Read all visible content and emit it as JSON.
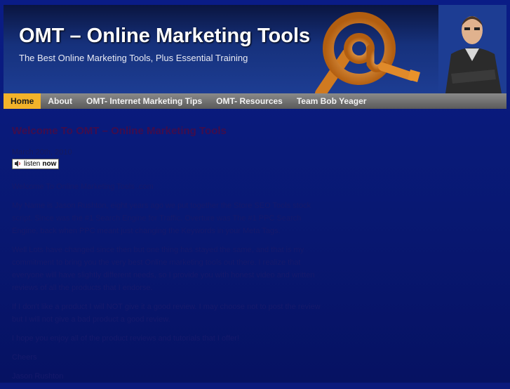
{
  "header": {
    "site_title": "OMT – Online Marketing Tools",
    "tagline": "The Best Online Marketing Tools, Plus Essential Training"
  },
  "nav": {
    "items": [
      {
        "label": "Home"
      },
      {
        "label": "About"
      },
      {
        "label": "OMT- Internet Marketing Tips"
      },
      {
        "label": "OMT- Resources"
      },
      {
        "label": "Team Bob Yeager"
      }
    ]
  },
  "post": {
    "title": "Welcome To OMT – Online Marketing Tools",
    "date": "March 20th, 2010",
    "listen_button": {
      "word1": "listen",
      "word2": "now"
    },
    "paragraphs": [
      "Welcome To Online Marketing Tools .com",
      "My Name is Jason Rushton, eight years ago we put together the Store SEO Tools stock script. Since was the #1 Search Engine for Traffic. Overture was The #1 PPC Search Engine, back when PPC meant just changing the Keywords in your Meta Tags.",
      "Well Lots have changed since then but one thing has stayed the same, and that is my commitment to bring you the very best Online marketing tools out there. I realize that everyone will have slightly different needs, so I provide you with honest video and written reviews of all the products that I endorse.",
      "If I don't like a product I will NOT give it a good review. I may choose not to post the review but I will not give a bad product a good review.",
      "I hope you enjoy all of the product reviews and tutorials that I offer!",
      "Cheers",
      "Jason Rushton"
    ]
  },
  "colors": {
    "page_background": "#0b1a7c",
    "nav_active": "#f2b32a",
    "nav_background": "#6e6e6e",
    "logo_orange": "#e8922a"
  },
  "icons": {
    "logo": "at-sign-wrench-icon",
    "speaker": "speaker-icon"
  }
}
